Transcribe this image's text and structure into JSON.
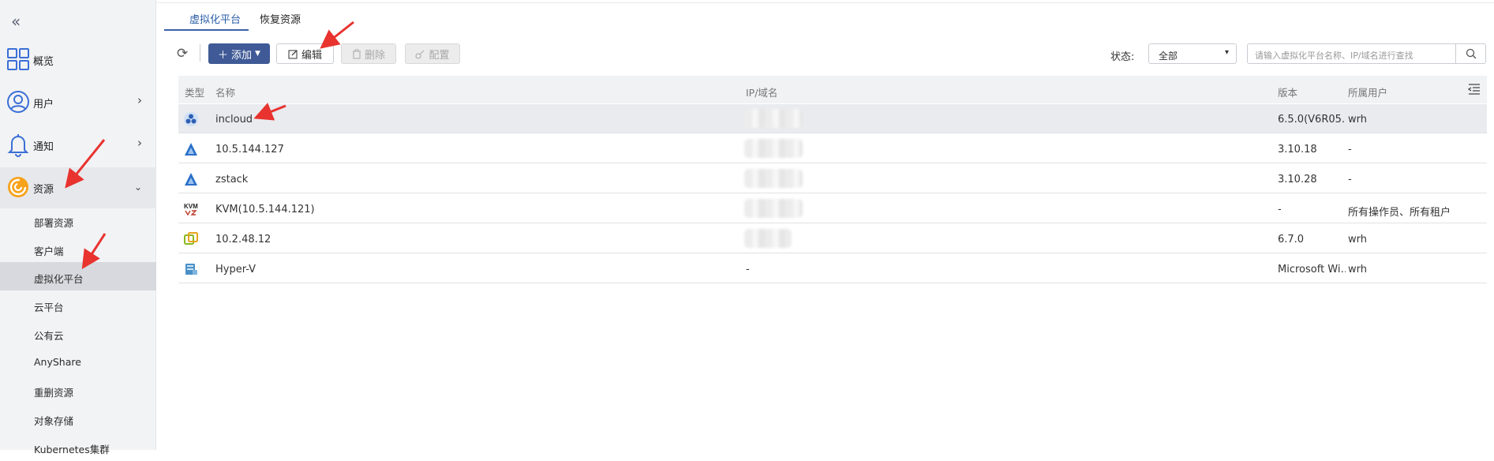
{
  "sidebar": {
    "collapse_icon": "double-chevron-left-icon",
    "groups": [
      {
        "label": "概览",
        "icon": "dashboard-grid-icon"
      },
      {
        "label": "用户",
        "icon": "user-circle-icon"
      },
      {
        "label": "通知",
        "icon": "bell-icon"
      },
      {
        "label": "资源",
        "icon": "resource-swirl-icon"
      }
    ],
    "sub_items": [
      {
        "label": "部署资源"
      },
      {
        "label": "客户端"
      },
      {
        "label": "虚拟化平台"
      },
      {
        "label": "云平台"
      },
      {
        "label": "公有云"
      },
      {
        "label": "AnyShare"
      },
      {
        "label": "重删资源"
      },
      {
        "label": "对象存储"
      },
      {
        "label": "Kubernetes集群"
      }
    ]
  },
  "tabs": [
    {
      "label": "虚拟化平台"
    },
    {
      "label": "恢复资源"
    }
  ],
  "toolbar": {
    "add_label": "添加",
    "edit_label": "编辑",
    "delete_label": "删除",
    "config_label": "配置",
    "status_label": "状态:",
    "status_value": "全部",
    "search_placeholder": "请输入虚拟化平台名称、IP/域名进行查找"
  },
  "table": {
    "headers": {
      "type": "类型",
      "name": "名称",
      "ip": "IP/域名",
      "version": "版本",
      "owner": "所属用户"
    },
    "rows": [
      {
        "icon": "incloud-icon",
        "name": "incloud",
        "ip": "",
        "version": "6.5.0(V6R05…",
        "owner": "wrh"
      },
      {
        "icon": "zstack-icon",
        "name": "10.5.144.127",
        "ip": "",
        "version": "3.10.18",
        "owner": "-"
      },
      {
        "icon": "zstack-icon",
        "name": "zstack",
        "ip": "",
        "version": "3.10.28",
        "owner": "-"
      },
      {
        "icon": "kvm-icon",
        "name": "KVM(10.5.144.121)",
        "ip": "",
        "version": "-",
        "owner": "所有操作员、所有租户"
      },
      {
        "icon": "vmware-icon",
        "name": "10.2.48.12",
        "ip": "",
        "version": "6.7.0",
        "owner": "wrh"
      },
      {
        "icon": "hyperv-icon",
        "name": "Hyper-V",
        "ip": "-",
        "version": "Microsoft Wi…",
        "owner": "wrh"
      }
    ]
  },
  "colors": {
    "accent": "#3f5a96",
    "tab_active": "#2d5fa8",
    "annotation_arrow": "#e8332f"
  }
}
